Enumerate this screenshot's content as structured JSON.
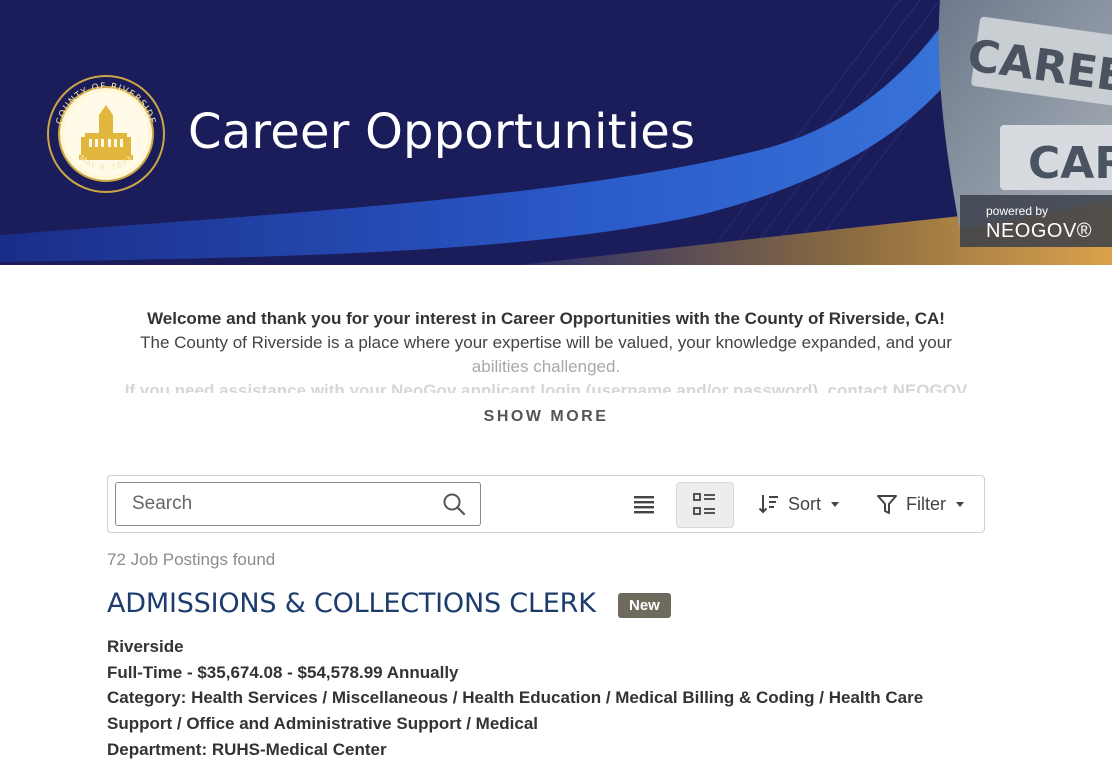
{
  "banner": {
    "title": "Career Opportunities",
    "seal_top_text": "COUNTY OF RIVERSIDE",
    "seal_bottom_text": "MAY 9, 1893",
    "powered_by": "powered by",
    "vendor": "NEOGOV®",
    "sign_text_1": "CAREER",
    "sign_text_2": "CAR",
    "colors": {
      "navy": "#1b1c5a",
      "blue": "#2a4fb8",
      "gold": "#d6a24a"
    }
  },
  "welcome": {
    "heading": "Welcome and thank you for your interest in Career Opportunities with the County of Riverside, CA!",
    "line1": "The County of Riverside is a place where your expertise will be valued, your knowledge expanded, and your",
    "line2": "abilities challenged.",
    "line3": "If you need assistance with your NeoGov applicant login (username and/or password), contact NEOGOV",
    "show_more": "SHOW MORE"
  },
  "toolbar": {
    "search_placeholder": "Search",
    "search_value": "",
    "sort_label": "Sort",
    "filter_label": "Filter"
  },
  "results": {
    "count_text": "72 Job Postings found"
  },
  "jobs": [
    {
      "title": "ADMISSIONS & COLLECTIONS CLERK",
      "badge": "New",
      "location": "Riverside",
      "type_salary": "Full-Time - $35,674.08 - $54,578.99 Annually",
      "category": "Category: Health Services / Miscellaneous / Health Education / Medical Billing & Coding / Health Care Support / Office and Administrative Support / Medical",
      "department": "Department: RUHS-Medical Center"
    }
  ]
}
